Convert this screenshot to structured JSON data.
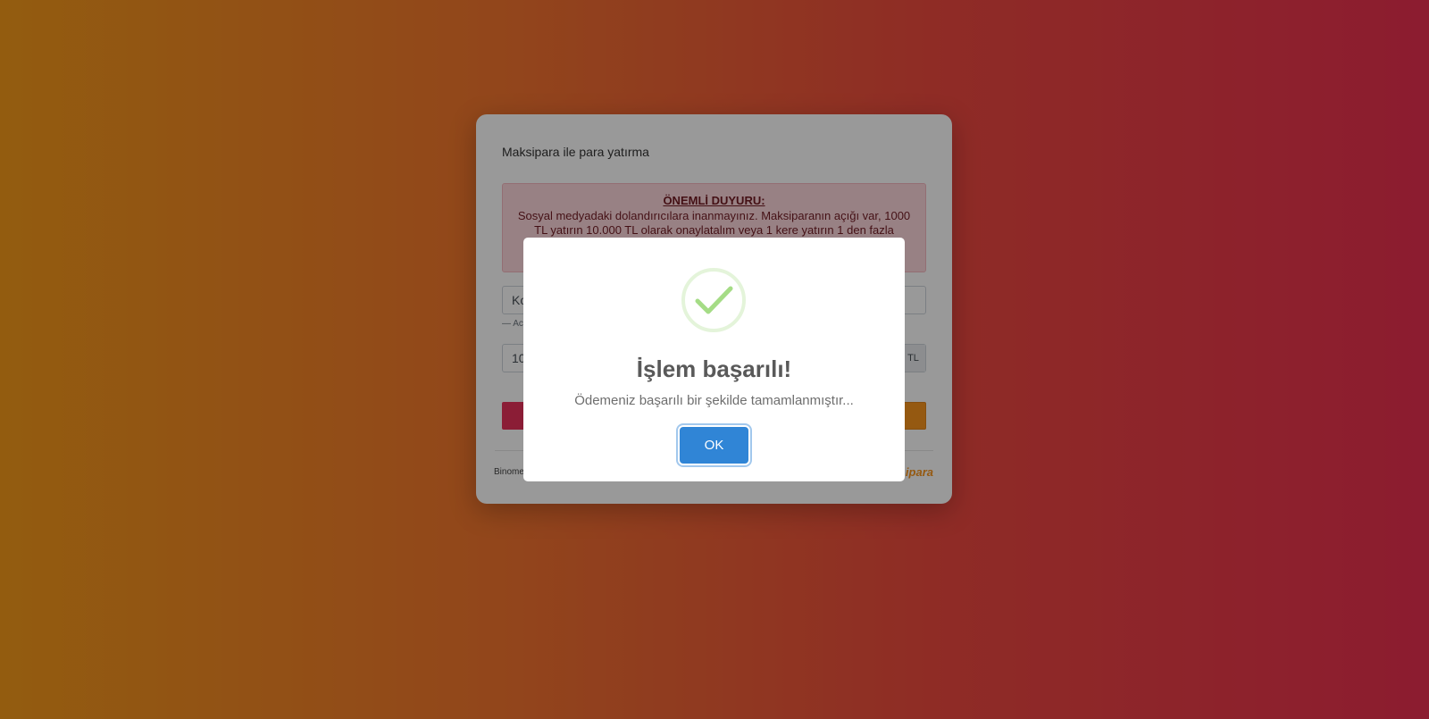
{
  "card": {
    "title": "Maksipara ile para yatırma",
    "notice_title": "ÖNEMLİ DUYURU:",
    "notice_text": "Sosyal medyadaki dolandırıcılara inanmayınız. Maksiparanın açığı var, 1000 TL yatırın 10.000 TL olarak onaylatalım veya 1 kere yatırın 1 den fazla",
    "account_partial": "Ko",
    "hint_partial": "— Ac",
    "amount_partial": "10",
    "amount_addon": "TL",
    "footer_partial": "Binome",
    "logo_partial": "ipara"
  },
  "modal": {
    "title": "İşlem başarılı!",
    "text": "Ödemeniz başarılı bir şekilde tamamlanmıştır...",
    "ok_label": "OK"
  },
  "colors": {
    "accent": "#3085d6",
    "success": "#a5dc86",
    "confirm": "#f8951d",
    "cancel": "#e8315a"
  }
}
